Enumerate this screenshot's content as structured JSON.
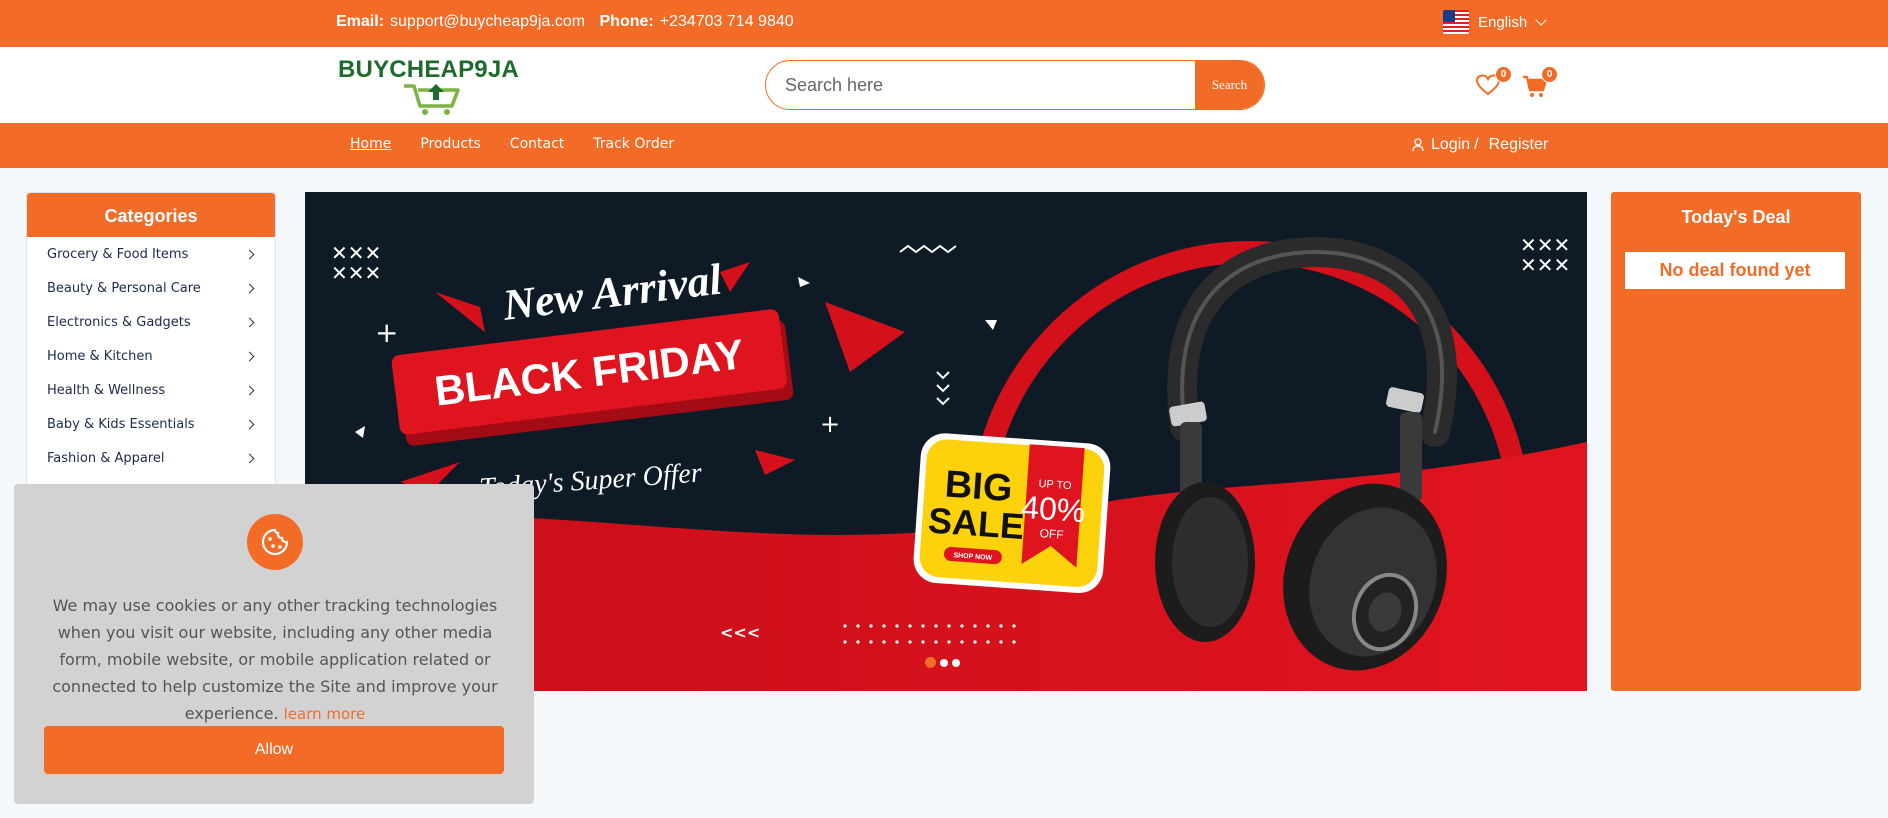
{
  "topbar": {
    "email_label": "Email:",
    "email_value": "support@buycheap9ja.com",
    "phone_label": "Phone:",
    "phone_value": "+234703 714 9840",
    "language": "English"
  },
  "header": {
    "logo_text": "BUYCHEAP9JA",
    "search_placeholder": "Search here",
    "search_button": "Search",
    "wishlist_count": "0",
    "cart_count": "0"
  },
  "nav": {
    "links": [
      "Home",
      "Products",
      "Contact",
      "Track Order"
    ],
    "login": "Login",
    "separator": "/",
    "register": "Register"
  },
  "categories": {
    "title": "Categories",
    "items": [
      "Grocery & Food Items",
      "Beauty & Personal Care",
      "Electronics & Gadgets",
      "Home & Kitchen",
      "Health & Wellness",
      "Baby & Kids Essentials",
      "Fashion & Apparel"
    ]
  },
  "banner": {
    "new_arrival": "New Arrival",
    "headline": "BLACK FRIDAY",
    "subline": "Today's Super Offer",
    "sale_big": "BIG",
    "sale_sale": "SALE",
    "upto": "UP TO",
    "percent": "40%",
    "off": "OFF",
    "shop_now": "SHOP NOW",
    "arrows": "<<<",
    "slides_total": 3,
    "active_slide": 1
  },
  "deal": {
    "title": "Today's Deal",
    "empty_text": "No deal found yet"
  },
  "cookie": {
    "text": "We may use cookies or any other tracking technologies when you visit our website, including any other media form, mobile website, or mobile application related or connected to help customize the Site and improve your experience.",
    "learn_more": "learn more",
    "allow": "Allow"
  },
  "colors": {
    "brand_orange": "#f36c27",
    "logo_green": "#1f6b2b",
    "banner_dark": "#0e1a26",
    "banner_red": "#d4101b"
  }
}
